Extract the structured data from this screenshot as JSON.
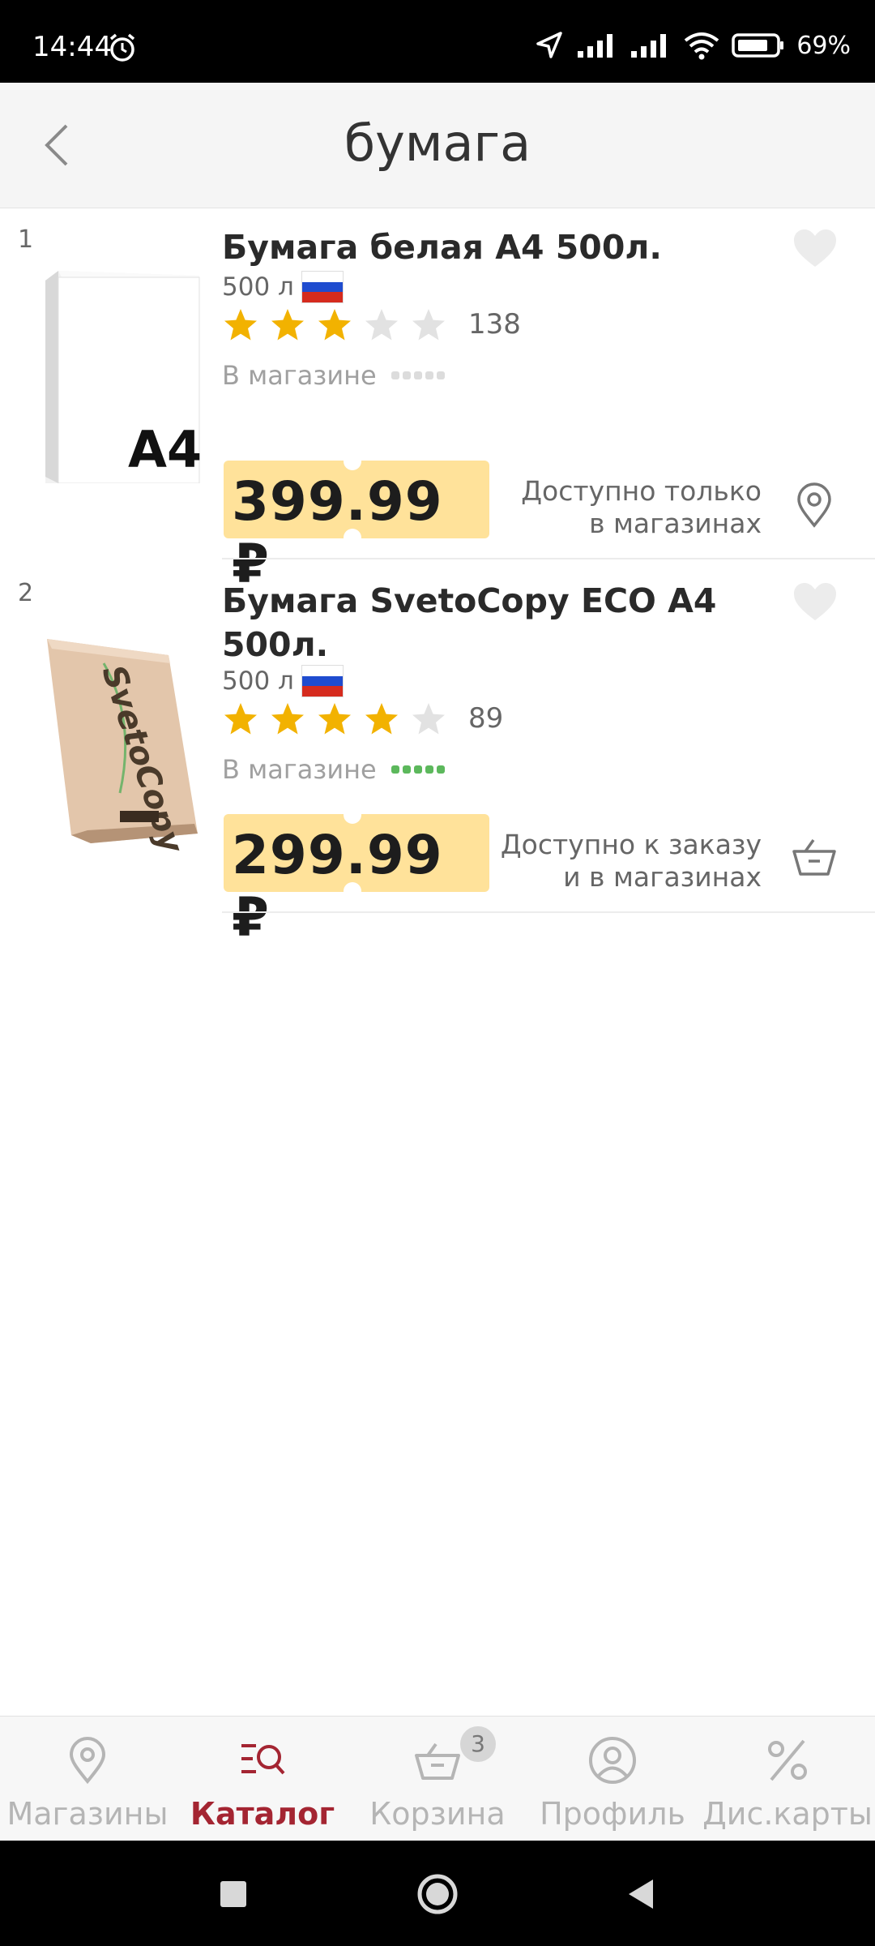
{
  "status_bar": {
    "time": "14:44",
    "battery": "69%"
  },
  "header": {
    "title": "бумага"
  },
  "products": [
    {
      "index": "1",
      "name": "Бумага белая А4 500л.",
      "volume": "500 л",
      "rating": 3,
      "reviews": "138",
      "stock_label": "В магазине",
      "stock_level": 0,
      "price": "399.99 ₽",
      "availability_line1": "Доступно только",
      "availability_line2": "в магазинах",
      "action_icon": "location-pin-icon",
      "image_label": "A4"
    },
    {
      "index": "2",
      "name": "Бумага SvetoCopy ECO A4 500л.",
      "volume": "500 л",
      "rating": 4,
      "reviews": "89",
      "stock_label": "В магазине",
      "stock_level": 5,
      "price": "299.99 ₽",
      "availability_line1": "Доступно к заказу",
      "availability_line2": "и в магазинах",
      "action_icon": "basket-icon",
      "image_label": "SvetoCopy"
    }
  ],
  "bottom_nav": {
    "items": [
      {
        "label": "Магазины",
        "icon": "location-pin-icon",
        "active": false
      },
      {
        "label": "Каталог",
        "icon": "catalog-search-icon",
        "active": true
      },
      {
        "label": "Корзина",
        "icon": "basket-icon",
        "active": false,
        "badge": "3"
      },
      {
        "label": "Профиль",
        "icon": "profile-icon",
        "active": false
      },
      {
        "label": "Дис.карты",
        "icon": "percent-icon",
        "active": false
      }
    ]
  },
  "colors": {
    "accent": "#a42532",
    "price_bg": "#ffe29a",
    "star_on": "#f2b200",
    "star_off": "#e2e2e2",
    "stock_green": "#5cb85c"
  }
}
